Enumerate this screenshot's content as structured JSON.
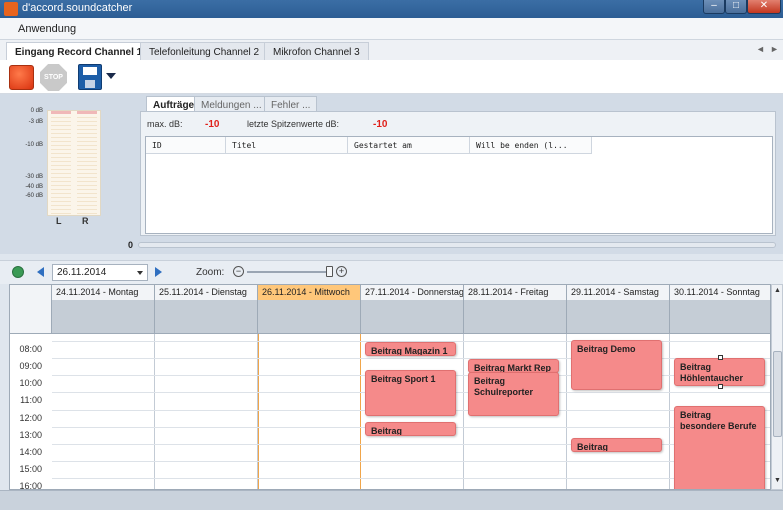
{
  "window": {
    "title": "d'accord.soundcatcher",
    "minimize": "–",
    "maximize": "□",
    "close": "✕"
  },
  "menu": {
    "items": [
      "Anwendung"
    ]
  },
  "channel_tabs": [
    {
      "label": "Eingang Record Channel 1",
      "active": true
    },
    {
      "label": "Telefonleitung Channel 2",
      "active": false
    },
    {
      "label": "Mikrofon Channel 3",
      "active": false
    }
  ],
  "channel_scroll": {
    "left": "◄",
    "right": "►"
  },
  "toolbar": {
    "stop_label": "STOP",
    "icons": [
      "record-icon",
      "stop-icon",
      "save-icon",
      "chevron-down-icon"
    ]
  },
  "meter": {
    "db_labels": [
      "0 dB",
      "-3 dB",
      "-10 dB",
      "-30 dB",
      "-40 dB",
      "-60 dB"
    ],
    "channels": [
      "L",
      "R"
    ]
  },
  "log": {
    "tabs": [
      "Aufträge",
      "Meldungen ...",
      "Fehler ..."
    ],
    "max_db_label": "max. dB:",
    "max_db_value": "-10",
    "peak_label": "letzte Spitzenwerte dB:",
    "peak_value": "-10",
    "columns": [
      "ID",
      "Titel",
      "Gestartet am",
      "Will be enden (l..."
    ]
  },
  "progress": {
    "label": "0",
    "value": 0
  },
  "calendar_toolbar": {
    "date": "26.11.2014",
    "zoom_label": "Zoom:",
    "zoom_level": 0.93,
    "zoom_out": "−",
    "zoom_in": "+"
  },
  "calendar": {
    "days": [
      "24.11.2014 - Montag",
      "25.11.2014 - Dienstag",
      "26.11.2014 - Mittwoch",
      "27.11.2014 - Donnerstag",
      "28.11.2014 - Freitag",
      "29.11.2014 - Samstag",
      "30.11.2014 - Sonntag"
    ],
    "today_index": 2,
    "hours": [
      "08:00",
      "09:00",
      "10:00",
      "11:00",
      "12:00",
      "13:00",
      "14:00",
      "15:00",
      "16:00"
    ],
    "events": [
      {
        "day": 3,
        "title": "Beitrag Magazin 1",
        "start": "08:00",
        "end": "08:40"
      },
      {
        "day": 3,
        "title": "Beitrag Sport 1",
        "start": "09:40",
        "end": "12:20"
      },
      {
        "day": 3,
        "title": "Beitrag Gewinnspie",
        "start": "12:40",
        "end": "13:15"
      },
      {
        "day": 4,
        "title": "Beitrag Markt Rep",
        "start": "09:00",
        "end": "09:45"
      },
      {
        "day": 4,
        "title": "Beitrag Schulreporter",
        "start": "09:45",
        "end": "12:20"
      },
      {
        "day": 5,
        "title": "Beitrag Demo",
        "start": "07:55",
        "end": "10:50"
      },
      {
        "day": 5,
        "title": "Beitrag Kegelverei",
        "start": "13:35",
        "end": "14:25"
      },
      {
        "day": 6,
        "title": "Beitrag Höhlentaucher",
        "start": "08:55",
        "end": "10:35"
      },
      {
        "day": 6,
        "title": "Beitrag besondere Berufe",
        "start": "11:45",
        "end": "16:50"
      }
    ],
    "selected_event": 7
  },
  "colors": {
    "event": "#f58a8a",
    "today": "#ffc77a",
    "stat_value": "#e0201a",
    "titlebar": "#2c5d94"
  }
}
